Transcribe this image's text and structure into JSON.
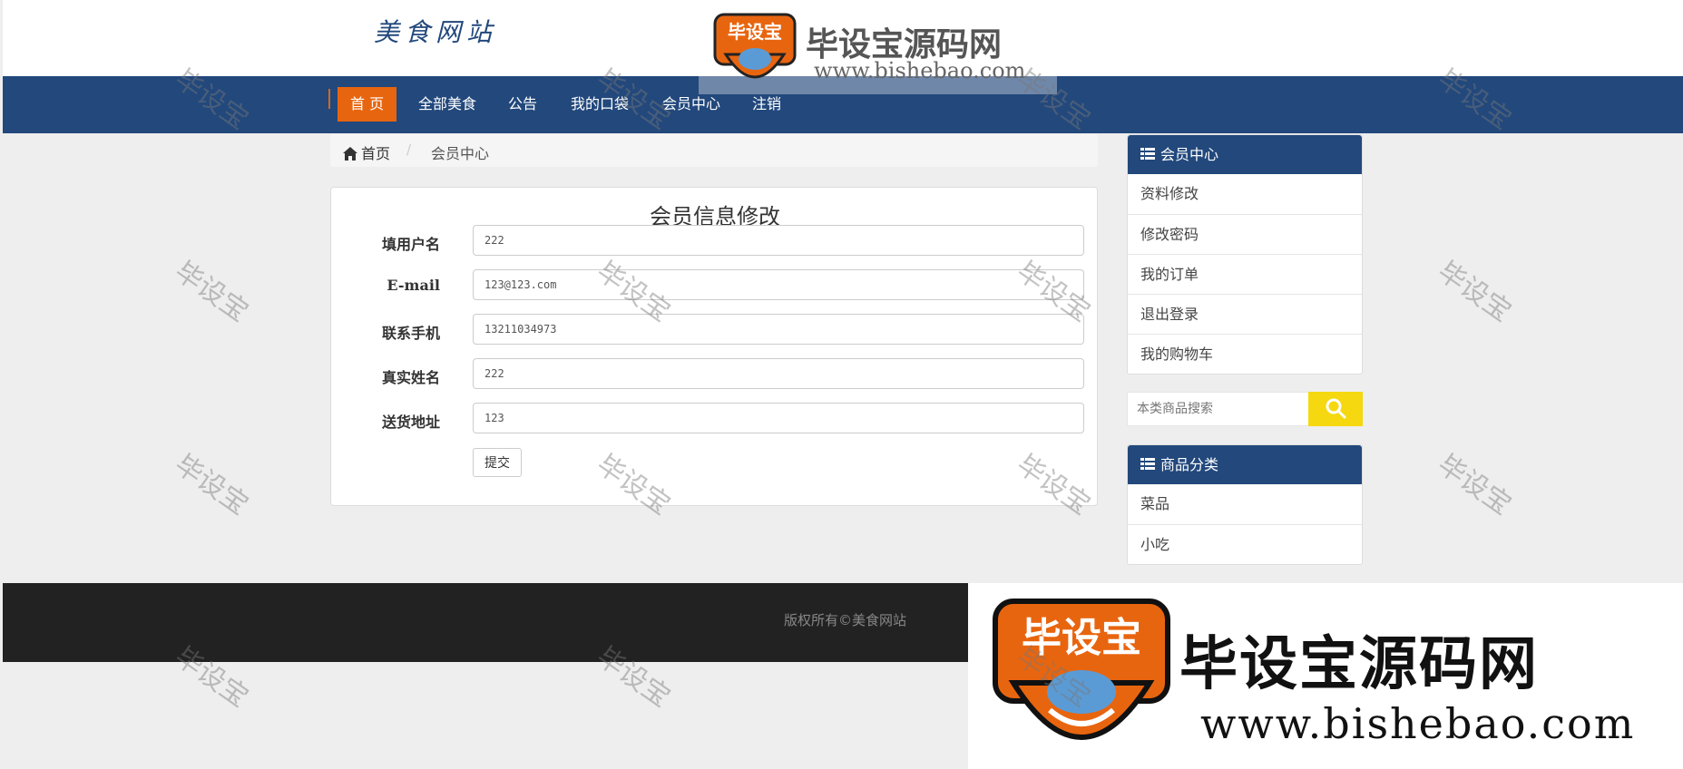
{
  "site": {
    "logo": "美食网站"
  },
  "nav": {
    "items": [
      {
        "label": "首 页",
        "active": true
      },
      {
        "label": "全部美食"
      },
      {
        "label": "公告"
      },
      {
        "label": "我的口袋"
      },
      {
        "label": "会员中心"
      },
      {
        "label": "注销"
      }
    ]
  },
  "breadcrumb": {
    "home": "首页",
    "separator": "/",
    "current": "会员中心"
  },
  "form": {
    "title": "会员信息修改",
    "fields": [
      {
        "label": "填用户名",
        "value": "222"
      },
      {
        "label": "E-mail",
        "value": "123@123.com"
      },
      {
        "label": "联系手机",
        "value": "13211034973"
      },
      {
        "label": "真实姓名",
        "value": "222"
      },
      {
        "label": "送货地址",
        "value": "123"
      }
    ],
    "submit_label": "提交"
  },
  "member_center": {
    "title": "会员中心",
    "items": [
      "资料修改",
      "修改密码",
      "我的订单",
      "退出登录",
      "我的购物车"
    ]
  },
  "search": {
    "placeholder": "本类商品搜索",
    "icon": "search-icon"
  },
  "categories": {
    "title": "商品分类",
    "items": [
      "菜品",
      "小吃"
    ]
  },
  "footer": {
    "copyright": "版权所有©美食网站"
  },
  "watermark": {
    "brand_text": "毕设宝源码网",
    "brand_url": "www.bishebao.com",
    "logo_text": "毕设宝",
    "overlay_text": "毕设宝"
  },
  "colors": {
    "navy": "#22487c",
    "orange": "#e8650f",
    "yellow": "#f5d80f",
    "footer": "#222222"
  }
}
